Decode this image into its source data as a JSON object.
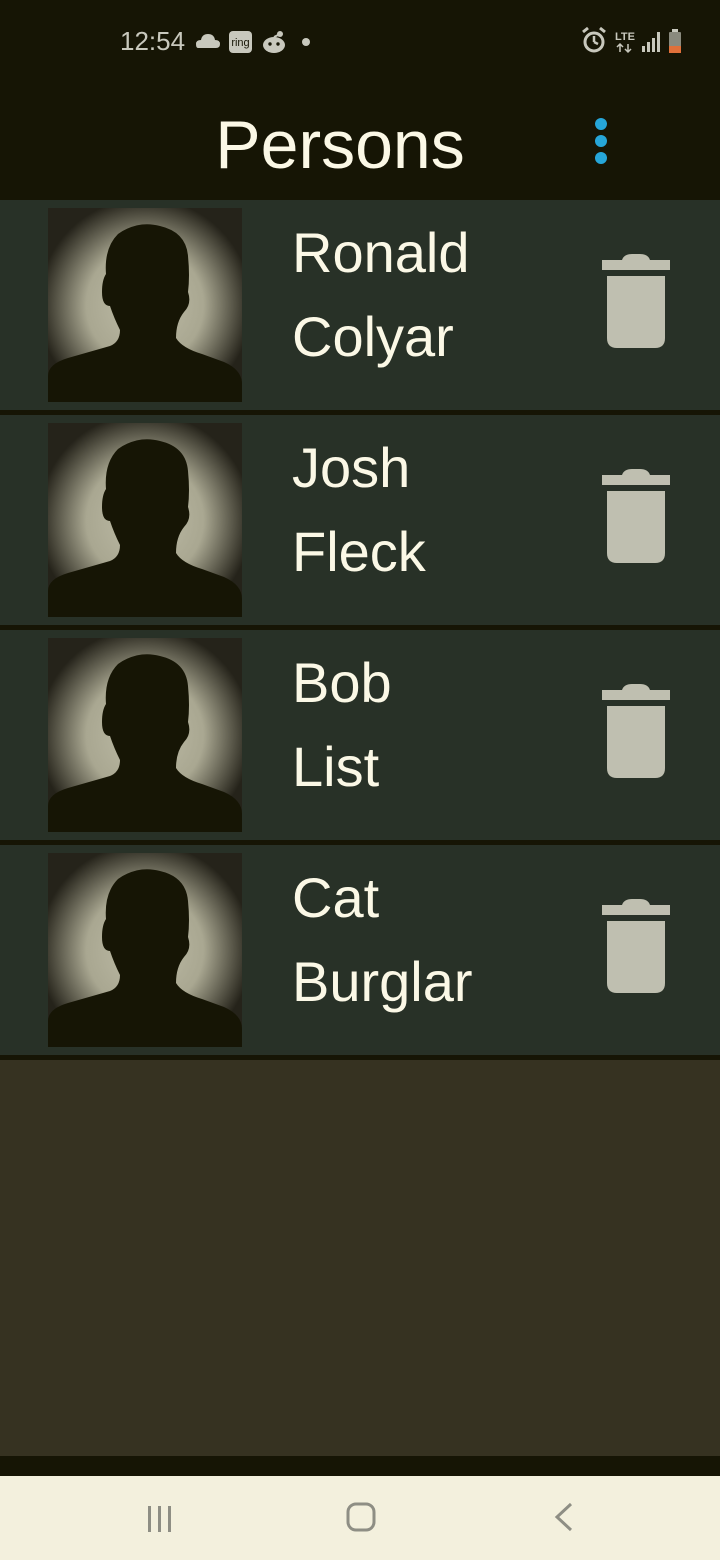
{
  "status_bar": {
    "time": "12:54",
    "left_icons": [
      "cloud-icon",
      "ring-app-icon",
      "reddit-icon",
      "dot-icon"
    ],
    "ring_label": "ring",
    "network_label": "LTE",
    "right_icons": [
      "alarm-icon",
      "lte-icon",
      "signal-icon",
      "battery-icon"
    ]
  },
  "app_bar": {
    "title": "Persons",
    "menu_icon": "overflow-menu-icon",
    "accent_color": "#26a6d9"
  },
  "persons": [
    {
      "first": "Ronald",
      "last": "Colyar"
    },
    {
      "first": "Josh",
      "last": "Fleck"
    },
    {
      "first": "Bob",
      "last": "List"
    },
    {
      "first": "Cat",
      "last": "Burglar"
    }
  ],
  "row_icons": {
    "avatar": "person-silhouette-icon",
    "delete": "trash-icon"
  },
  "nav_bar": {
    "icons": [
      "recent-apps-icon",
      "home-icon",
      "back-icon"
    ]
  }
}
